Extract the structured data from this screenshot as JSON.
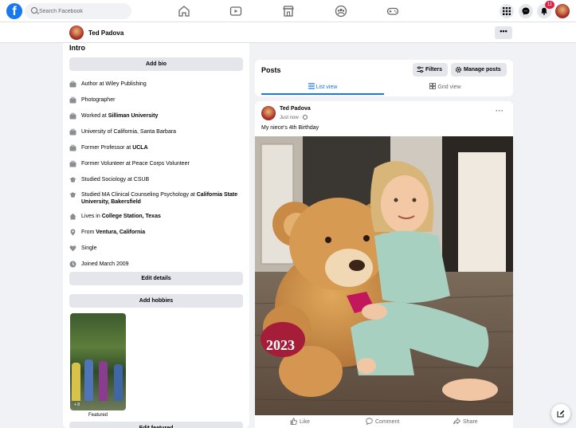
{
  "topbar": {
    "logo": "f",
    "search_placeholder": "Search Facebook",
    "nav_icons": [
      "home-icon",
      "watch-icon",
      "marketplace-icon",
      "groups-icon",
      "gaming-icon"
    ],
    "notifications_badge": "11"
  },
  "profile_header": {
    "name": "Ted Padova",
    "more_label": "•••"
  },
  "intro": {
    "title": "Intro",
    "add_bio_label": "Add bio",
    "items": [
      {
        "icon": "briefcase-icon",
        "prefix": "Author at Wiley Publishing",
        "bold": ""
      },
      {
        "icon": "briefcase-icon",
        "prefix": "Photographer",
        "bold": ""
      },
      {
        "icon": "briefcase-icon",
        "prefix": "Worked at ",
        "bold": "Silliman University"
      },
      {
        "icon": "briefcase-icon",
        "prefix": "University of California, Santa Barbara",
        "bold": ""
      },
      {
        "icon": "briefcase-icon",
        "prefix": "Former Professor at ",
        "bold": "UCLA"
      },
      {
        "icon": "briefcase-icon",
        "prefix": "Former Volunteer at Peace Corps Volunteer",
        "bold": ""
      },
      {
        "icon": "graduation-cap-icon",
        "prefix": "Studied Sociology at CSUB",
        "bold": ""
      },
      {
        "icon": "graduation-cap-icon",
        "prefix": "Studied MA Clinical Counseling Psychology at ",
        "bold": "California State University, Bakersfield"
      },
      {
        "icon": "home-icon",
        "prefix": "Lives in ",
        "bold": "College Station, Texas"
      },
      {
        "icon": "location-pin-icon",
        "prefix": "From ",
        "bold": "Ventura, California"
      },
      {
        "icon": "heart-icon",
        "prefix": "Single",
        "bold": ""
      },
      {
        "icon": "clock-icon",
        "prefix": "Joined March 2009",
        "bold": ""
      }
    ],
    "edit_details_label": "Edit details",
    "add_hobbies_label": "Add hobbies",
    "featured_count": "+ 8",
    "featured_label": "Featured",
    "edit_featured_label": "Edit featured"
  },
  "posts": {
    "title": "Posts",
    "filters_label": "Filters",
    "manage_posts_label": "Manage posts",
    "list_view_label": "List view",
    "grid_view_label": "Grid view"
  },
  "post": {
    "author": "Ted Padova",
    "time": "Just now · ",
    "text": "My niece's 4th Birthday",
    "more_label": "···",
    "photo_text": "2023",
    "like_label": "Like",
    "comment_label": "Comment",
    "share_label": "Share"
  },
  "colors": {
    "brand": "#1877f2",
    "badge": "#e41e3f",
    "background": "#f0f2f5"
  }
}
